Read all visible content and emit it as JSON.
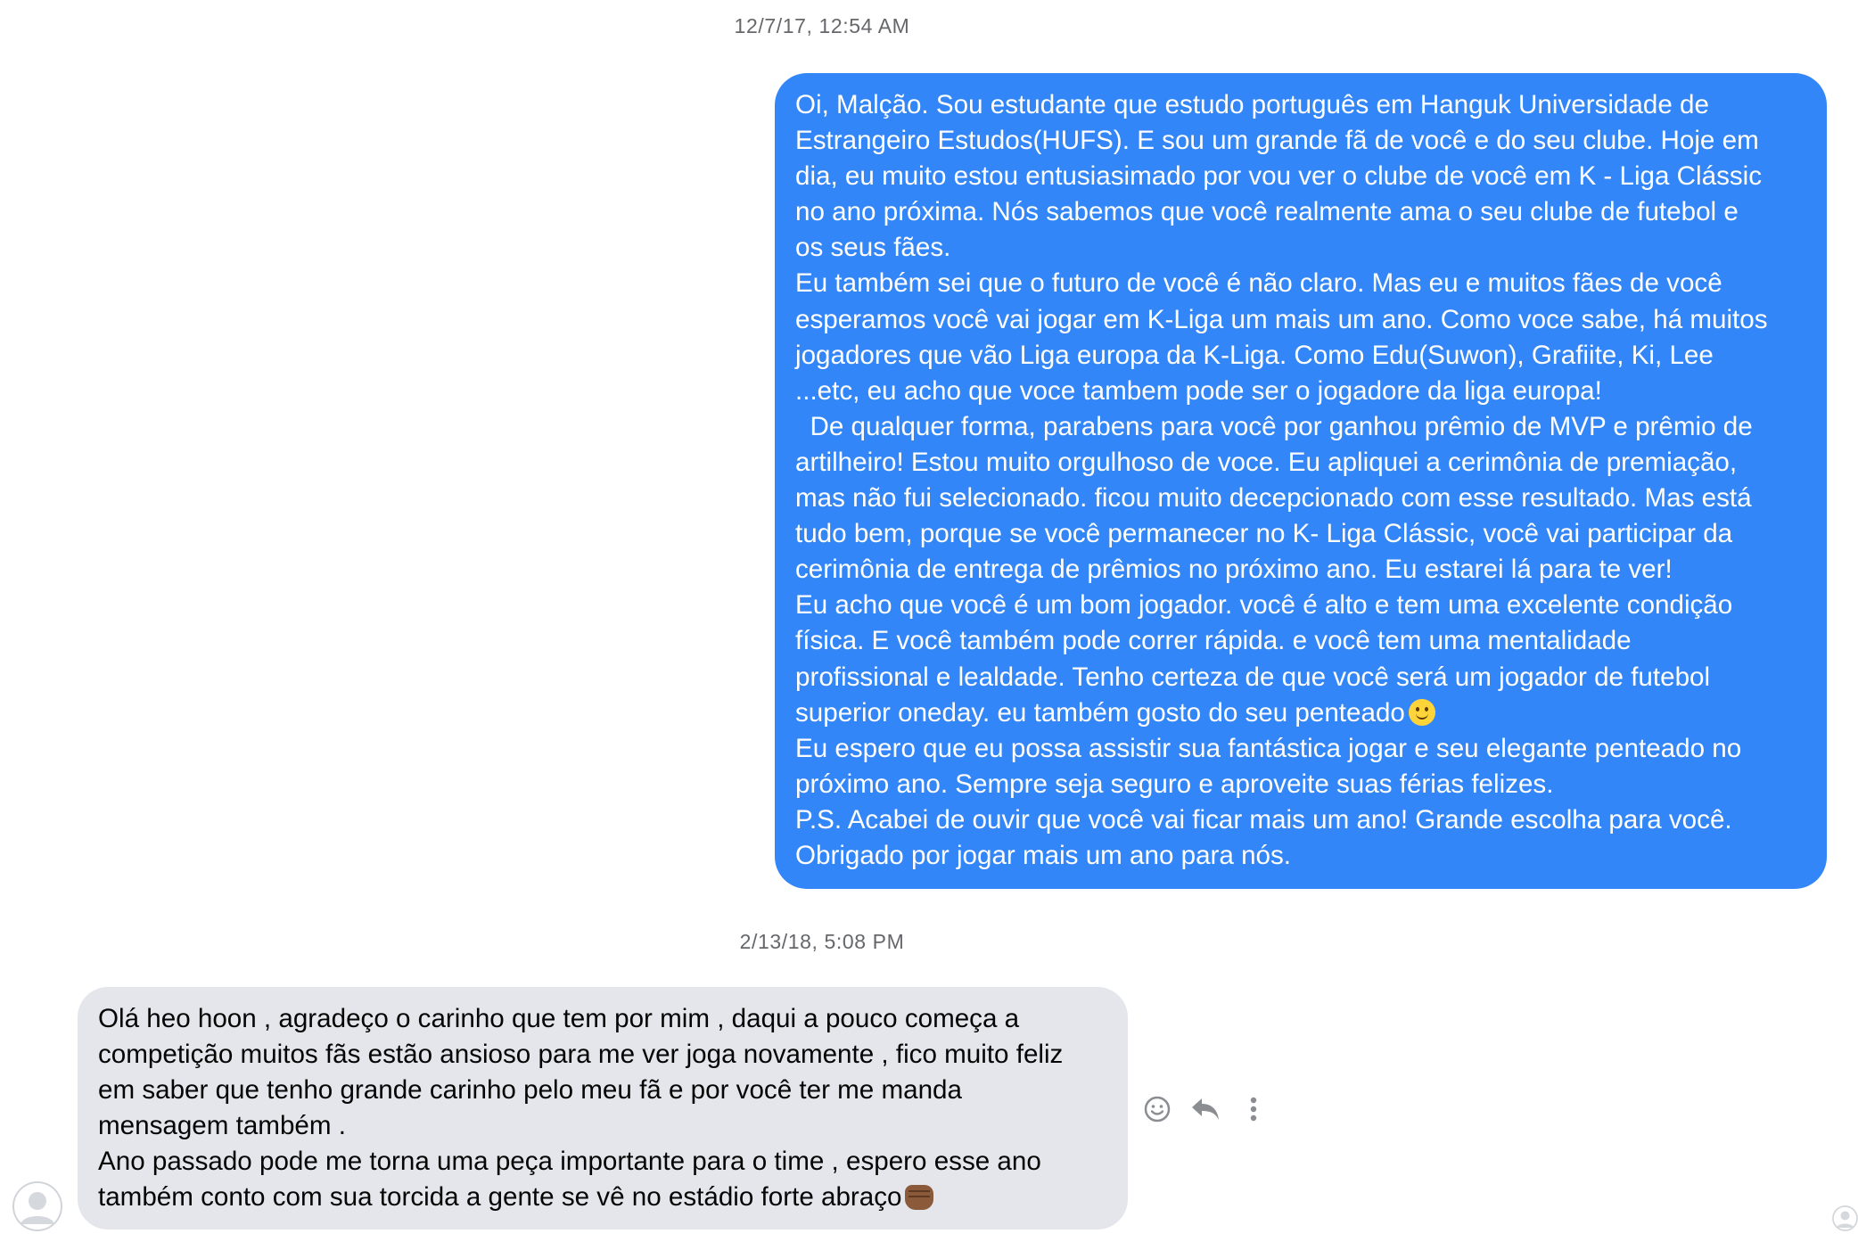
{
  "conversation": {
    "timestamp_1": "12/7/17, 12:54 AM",
    "outgoing_message": "Oi, Malção. Sou estudante que estudo português em Hanguk Universidade de\nEstrangeiro Estudos(HUFS). E sou um grande fã de você e do seu clube. Hoje em\ndia, eu muito estou entusiasimado por vou ver o clube de você em K - Liga Clássic\nno ano próxima. Nós sabemos que você realmente ama o seu clube de futebol e\nos seus fães.\nEu também sei que o futuro de você é não claro. Mas eu e muitos fães de você\nesperamos você vai jogar em K-Liga um mais um ano. Como voce sabe, há muitos\njogadores que vão Liga europa da K-Liga. Como Edu(Suwon), Grafiite, Ki, Lee\n...etc, eu acho que voce tambem pode ser o jogadore da liga europa!\n  De qualquer forma, parabens para você por ganhou prêmio de MVP e prêmio de\nartilheiro! Estou muito orgulhoso de voce. Eu apliquei a cerimônia de premiação,\nmas não fui selecionado. ficou muito decepcionado com esse resultado. Mas está\ntudo bem, porque se você permanecer no K- Liga Clássic, você vai participar da\ncerimônia de entrega de prêmios no próximo ano. Eu estarei lá para te ver!\nEu acho que você é um bom jogador. você é alto e tem uma excelente condição\nfísica. E você também pode correr rápida. e você tem uma mentalidade\nprofissional e lealdade. Tenho certeza de que você será um jogador de futebol\nsuperior oneday. eu também gosto do seu penteado",
    "outgoing_message_tail": "\nEu espero que eu possa assistir sua fantástica jogar e seu elegante penteado no\npróximo ano. Sempre seja seguro e aproveite suas férias felizes.\nP.S. Acabei de ouvir que você vai ficar mais um ano! Grande escolha para você.\nObrigado por jogar mais um ano para nós.",
    "timestamp_2": "2/13/18, 5:08 PM",
    "incoming_message": "Olá heo hoon , agradeço o carinho que tem por mim , daqui a pouco começa a\ncompetição muitos fãs estão ansioso para me ver joga novamente , fico muito feliz\nem saber que tenho grande carinho pelo meu fã e por você ter me manda\nmensagem também .\nAno passado pode me torna uma peça importante para o time , espero esse ano\ntambém conto com sua torcida a gente se vê no estádio forte abraço"
  },
  "icons": {
    "outgoing_emoji": "slightly-smiling-face-emoji",
    "incoming_emoji": "oncoming-fist-emoji",
    "react": "smiley-icon",
    "reply": "reply-icon",
    "more": "more-vertical-icon",
    "avatar": "default-avatar-icon"
  },
  "colors": {
    "outgoing_bubble": "#3386f7",
    "incoming_bubble": "#e4e6eb",
    "timestamp_text": "#65676b",
    "icon_gray": "#8a8d91"
  }
}
